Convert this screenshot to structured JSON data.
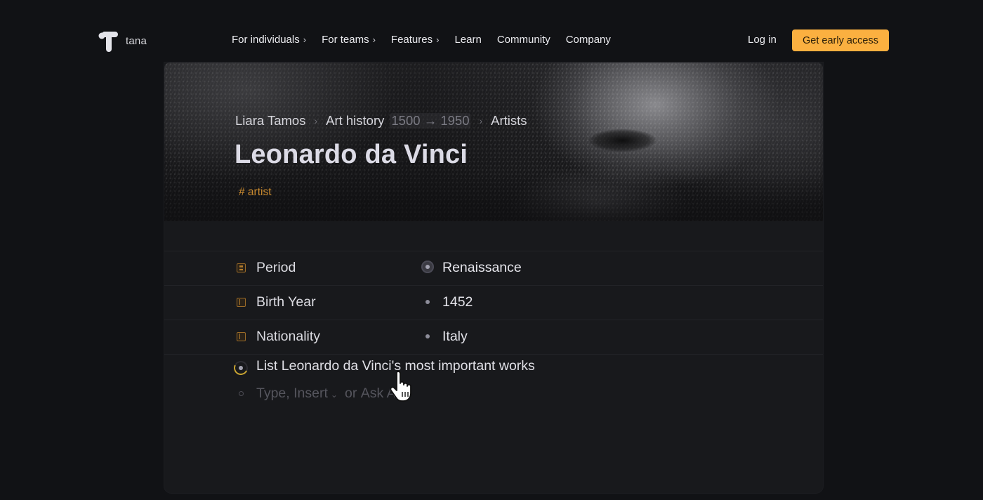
{
  "nav": {
    "logo_text": "tana",
    "links": [
      {
        "label": "For individuals",
        "has_chevron": true
      },
      {
        "label": "For teams",
        "has_chevron": true
      },
      {
        "label": "Features",
        "has_chevron": true
      },
      {
        "label": "Learn",
        "has_chevron": false
      },
      {
        "label": "Community",
        "has_chevron": false
      },
      {
        "label": "Company",
        "has_chevron": false
      }
    ],
    "chevron_glyph": "›",
    "login_label": "Log in",
    "cta_label": "Get early access",
    "cta_color": "#fbb040"
  },
  "node": {
    "breadcrumb": {
      "items": [
        "Liara Tamos",
        "Art history",
        "Artists"
      ],
      "range": "1500 → 1950",
      "separator": "›"
    },
    "title": "Leonardo da Vinci",
    "tag": "# artist",
    "tag_color": "#c98a2f",
    "fields": [
      {
        "label": "Period",
        "value": "Renaissance",
        "label_icon": "options-field-icon",
        "value_icon": "reference-node-icon"
      },
      {
        "label": "Birth Year",
        "value": "1452",
        "label_icon": "plain-field-icon",
        "value_icon": "bullet-icon"
      },
      {
        "label": "Nationality",
        "value": "Italy",
        "label_icon": "plain-field-icon",
        "value_icon": "bullet-icon"
      }
    ],
    "task": {
      "text": "List Leonardo da Vinci's most important works",
      "icon": "ai-loading-spinner-icon"
    },
    "input": {
      "placeholder_parts": [
        "Type,",
        "Insert",
        "or",
        "Ask AI"
      ],
      "dropdown_glyph": "⌄"
    }
  }
}
